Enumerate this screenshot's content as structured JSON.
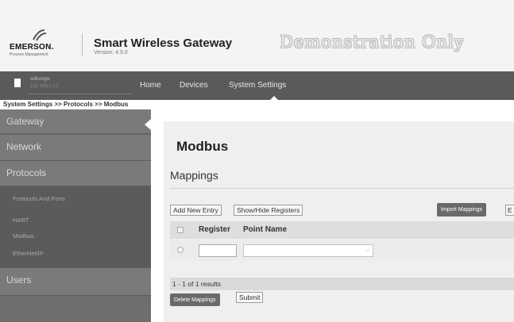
{
  "header": {
    "logo": {
      "name": "EMERSON.",
      "sub": "Process Management",
      "icon": "emerson-logo-mark"
    },
    "title": "Smart Wireless Gateway",
    "version": "Version: 4.5.0",
    "watermark": "Demonstration Only"
  },
  "navbar": {
    "device": {
      "name": "wilburtgw",
      "ip": "192.168.1.10",
      "icon": "device-icon"
    },
    "items": [
      "Home",
      "Devices",
      "System Settings"
    ],
    "active": "System Settings"
  },
  "breadcrumb": "System Settings >> Protocols >> Modbus",
  "sidebar": {
    "items": [
      {
        "label": "Gateway"
      },
      {
        "label": "Network"
      },
      {
        "label": "Protocols"
      },
      {
        "label": "Users"
      }
    ],
    "sub_items": [
      {
        "label": "Protocols And Ports"
      },
      {
        "label": "HART"
      },
      {
        "label": "Modbus"
      },
      {
        "label": "EtherNet/IP"
      }
    ],
    "active_sub": "Modbus"
  },
  "main": {
    "title": "Modbus",
    "section": "Mappings",
    "toolbar": {
      "add_label": "Add New Entry",
      "showhide_label": "Show/Hide Registers",
      "import_label": "Import Mappings",
      "cutoff_label": "E"
    },
    "table": {
      "columns": [
        "Register",
        "Point Name"
      ],
      "rows": [
        {
          "register": "",
          "point_name": ""
        }
      ]
    },
    "results": "1 - 1 of 1 results",
    "delete_label": "Delete Mappings",
    "submit_label": "Submit"
  },
  "colors": {
    "nav_bg": "#5a5a5a",
    "sidebar_bg": "#7a7a7a",
    "sidebar_sub_bg": "#5b5b5b",
    "content_bg": "#efefef",
    "action_button": "#6a6a6a"
  }
}
